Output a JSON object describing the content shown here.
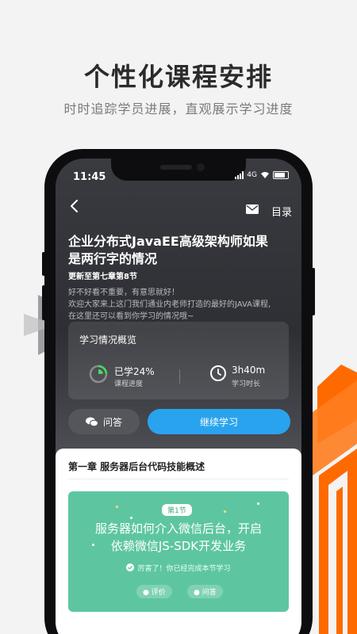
{
  "promo": {
    "title": "个性化课程安排",
    "subtitle": "时时追踪学员进展，直观展示学习进度",
    "accent_color": "#ff6a00",
    "gray_color": "#8d8e92"
  },
  "status_bar": {
    "time": "11:45",
    "network": "4G"
  },
  "nav": {
    "back_icon": "chevron-left-icon",
    "mail_icon": "mail-icon",
    "menu_label": "目录"
  },
  "course": {
    "title_line1": "企业分布式JavaEE高级架构师如果",
    "title_line2": "是两行字的情况",
    "update": "更新至第七章第8节",
    "desc_line1": "好不好看不重要，有意思就好！",
    "desc_line2": "欢迎大家来上这门我们通业内老师打造的最好的JAVA课程,",
    "desc_line3": "在这里还可以看到你学习的情况哦~"
  },
  "progress": {
    "title": "学习情况概览",
    "studied": "已学24%",
    "studied_fraction": 0.24,
    "studied_label": "课程进度",
    "time": "3h40m",
    "time_label": "学习时长",
    "ring_color": "#4cd964"
  },
  "actions": {
    "qa_label": "问答",
    "continue_label": "继续学习",
    "continue_color": "#2aa3ee"
  },
  "chapter": {
    "title": "第一章 服务器后台代码技能概述",
    "lesson": {
      "badge": "第1节",
      "title_line1": "服务器如何介入微信后台，开启",
      "title_line2": "依赖微信JS-SDK开发业务",
      "done_text": "厉害了！你已经完成本节学习",
      "rate_label": "评价",
      "qa_label": "问答",
      "color": "#5dc6a1"
    }
  }
}
